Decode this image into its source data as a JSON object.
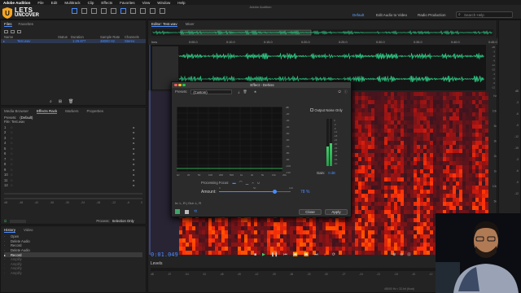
{
  "app": {
    "name": "Adobe Audition",
    "window_title": "Adobe Audition"
  },
  "menu": [
    "File",
    "Edit",
    "Multitrack",
    "Clip",
    "Effects",
    "Favorites",
    "View",
    "Window",
    "Help"
  ],
  "logo": {
    "line1": "LETS",
    "line2": "UNCOVER"
  },
  "workspaces": {
    "default": "Default",
    "edit_audio": "Edit Audio to Video",
    "radio": "Radio Production",
    "search_placeholder": "Search Help"
  },
  "files_panel": {
    "tabs": [
      "Files",
      "Favorites"
    ],
    "headers": [
      "Name",
      "Status",
      "Duration",
      "Sample Rate",
      "Channels"
    ],
    "file": {
      "name": "Test.wav",
      "duration": "1:29.877",
      "rate": "48000 Hz",
      "channels": "Stereo"
    }
  },
  "effects_rack": {
    "tabs": [
      "Media Browser",
      "Effects Rack",
      "Markers",
      "Properties"
    ],
    "presets_label": "Presets:",
    "preset_value": "(Default)",
    "file_label": "File: Test.wav",
    "slot_numbers": [
      "1",
      "2",
      "3",
      "4",
      "5",
      "6",
      "7",
      "8",
      "9",
      "10",
      "11",
      "12"
    ],
    "process_label": "Process:",
    "process_value": "Selection Only",
    "db_marks": [
      "dB",
      "-48",
      "-42",
      "-36",
      "-30",
      "-24",
      "-18",
      "-12",
      "-6",
      "0"
    ]
  },
  "history": {
    "tabs": [
      "History",
      "Video"
    ],
    "items": [
      "Open",
      "Delete Audio",
      "Record",
      "Delete Audio",
      "Record",
      "Amplify",
      "Amplify",
      "Amplify",
      "Amplify"
    ]
  },
  "editor": {
    "tabs": [
      "Editor: Test.wav",
      "Mixer"
    ],
    "ruler": [
      "hms",
      "0:05.0",
      "0:10.0",
      "0:15.0",
      "0:20.0",
      "0:25.0",
      "0:30.0",
      "0:35.0",
      "0:40.0",
      "0:45.0"
    ],
    "amplitude_labels": [
      "dB",
      "-3",
      "-6",
      "-9",
      "-12",
      "-15",
      "-3",
      "-6",
      "-9",
      "-12"
    ],
    "freq_labels": [
      "Hz",
      "10k",
      "5k",
      "3k",
      "2k",
      "1k",
      "10k",
      "5k",
      "3k",
      "2k",
      "1k"
    ],
    "time": "0:01.049",
    "levels_label": "Levels",
    "levels_marks": [
      "dB",
      "-57",
      "-54",
      "-51",
      "-48",
      "-45",
      "-42",
      "-39",
      "-36",
      "-33",
      "-30",
      "-27",
      "-24",
      "-21",
      "-18",
      "-15",
      "-12",
      "-9",
      "-6",
      "-3",
      "0"
    ],
    "status": "48000 Hz • 32-bit (float)"
  },
  "dialog": {
    "title": "Effect - Dehiss",
    "presets_label": "Presets:",
    "preset_value": "(Custom)",
    "output_noise_only": "Output Noise Only",
    "graph_y": [
      "dB",
      "-20",
      "-30",
      "-40",
      "-50",
      "-60",
      "-70",
      "-80",
      "-90",
      "-100",
      "-110"
    ],
    "graph_x": [
      "Hz",
      "20",
      "50",
      "100",
      "200",
      "500",
      "1k",
      "2k",
      "5k",
      "10k",
      "20k"
    ],
    "gain_label": "Gain:",
    "gain_value": "0 dB",
    "meter_marks": [
      "0",
      "-3",
      "-6",
      "-12",
      "-18",
      "-24",
      "-30",
      "-36",
      "-42",
      "-48",
      "-54",
      "-60"
    ],
    "processing_focus_label": "Processing Focus:",
    "amount_label": "Amount:",
    "amount_ticks": [
      "0",
      "50",
      "100"
    ],
    "amount_value": 78,
    "amount_text": "78 %",
    "channel_map": "In: L, R | Out: L, R",
    "close_label": "Close",
    "apply_label": "Apply"
  },
  "colors": {
    "accent": "#4a8cff",
    "waveform": "#2fd38a",
    "spectral_hot": "#ff7a1a",
    "spectral_cold": "#280018"
  },
  "icons": [
    "play-icon",
    "stop-icon",
    "record-icon",
    "loop-icon",
    "power-icon",
    "trash-icon",
    "save-preset-icon",
    "star-icon",
    "info-icon",
    "search-icon"
  ]
}
